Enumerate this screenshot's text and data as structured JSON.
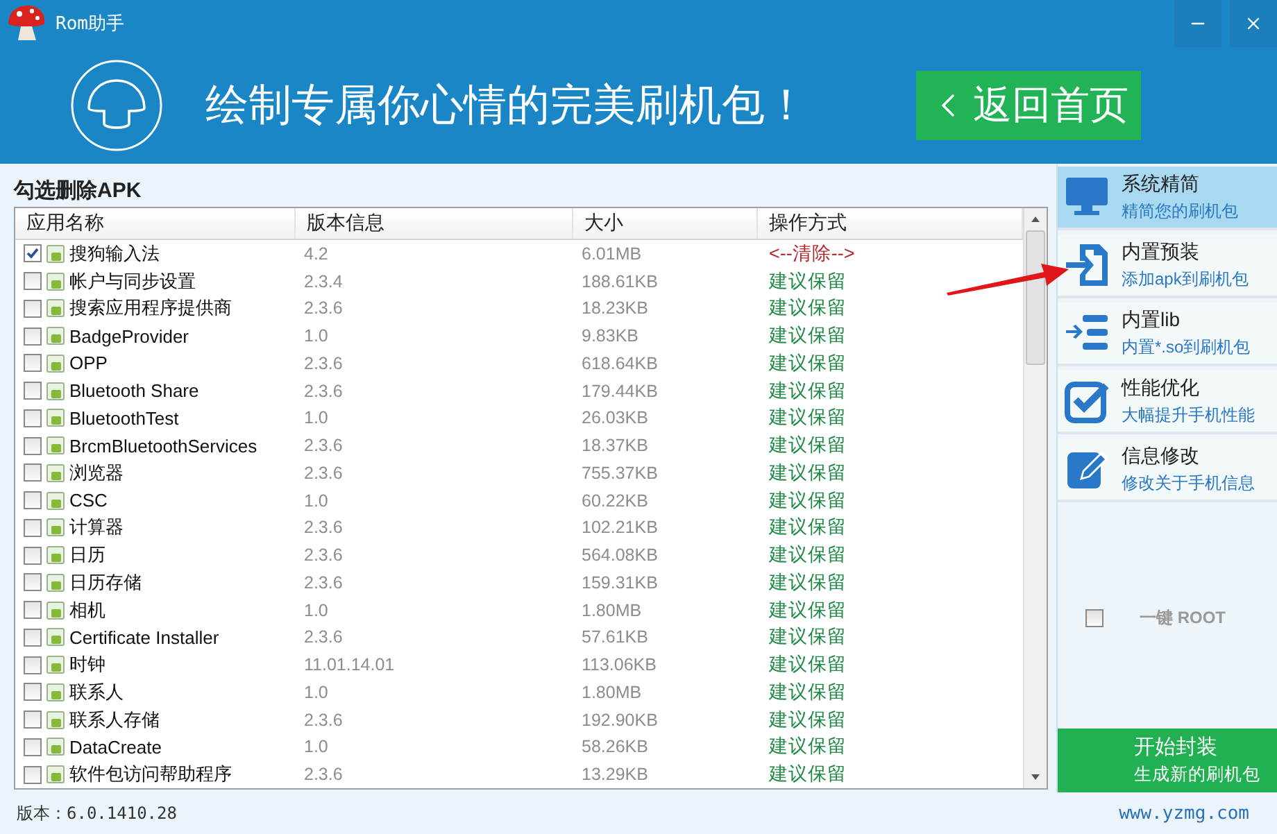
{
  "window": {
    "title": "Rom助手"
  },
  "banner": {
    "slogan": "绘制专属你心情的完美刷机包！",
    "back_button": "返回首页"
  },
  "panel_title": "勾选删除APK",
  "table": {
    "columns": [
      "应用名称",
      "版本信息",
      "大小",
      "操作方式"
    ],
    "rows": [
      {
        "checked": true,
        "name": "搜狗输入法",
        "version": "4.2",
        "size": "6.01MB",
        "action": "<--清除-->",
        "kind": "remove"
      },
      {
        "checked": false,
        "name": "帐户与同步设置",
        "version": "2.3.4",
        "size": "188.61KB",
        "action": "建议保留",
        "kind": "keep"
      },
      {
        "checked": false,
        "name": "搜索应用程序提供商",
        "version": "2.3.6",
        "size": "18.23KB",
        "action": "建议保留",
        "kind": "keep"
      },
      {
        "checked": false,
        "name": "BadgeProvider",
        "version": "1.0",
        "size": "9.83KB",
        "action": "建议保留",
        "kind": "keep"
      },
      {
        "checked": false,
        "name": "OPP",
        "version": "2.3.6",
        "size": "618.64KB",
        "action": "建议保留",
        "kind": "keep"
      },
      {
        "checked": false,
        "name": "Bluetooth Share",
        "version": "2.3.6",
        "size": "179.44KB",
        "action": "建议保留",
        "kind": "keep"
      },
      {
        "checked": false,
        "name": "BluetoothTest",
        "version": "1.0",
        "size": "26.03KB",
        "action": "建议保留",
        "kind": "keep"
      },
      {
        "checked": false,
        "name": "BrcmBluetoothServices",
        "version": "2.3.6",
        "size": "18.37KB",
        "action": "建议保留",
        "kind": "keep"
      },
      {
        "checked": false,
        "name": "浏览器",
        "version": "2.3.6",
        "size": "755.37KB",
        "action": "建议保留",
        "kind": "keep"
      },
      {
        "checked": false,
        "name": "CSC",
        "version": "1.0",
        "size": "60.22KB",
        "action": "建议保留",
        "kind": "keep"
      },
      {
        "checked": false,
        "name": "计算器",
        "version": "2.3.6",
        "size": "102.21KB",
        "action": "建议保留",
        "kind": "keep"
      },
      {
        "checked": false,
        "name": "日历",
        "version": "2.3.6",
        "size": "564.08KB",
        "action": "建议保留",
        "kind": "keep"
      },
      {
        "checked": false,
        "name": "日历存储",
        "version": "2.3.6",
        "size": "159.31KB",
        "action": "建议保留",
        "kind": "keep"
      },
      {
        "checked": false,
        "name": "相机",
        "version": "1.0",
        "size": "1.80MB",
        "action": "建议保留",
        "kind": "keep"
      },
      {
        "checked": false,
        "name": "Certificate Installer",
        "version": "2.3.6",
        "size": "57.61KB",
        "action": "建议保留",
        "kind": "keep"
      },
      {
        "checked": false,
        "name": "时钟",
        "version": "11.01.14.01",
        "size": "113.06KB",
        "action": "建议保留",
        "kind": "keep"
      },
      {
        "checked": false,
        "name": "联系人",
        "version": "1.0",
        "size": "1.80MB",
        "action": "建议保留",
        "kind": "keep"
      },
      {
        "checked": false,
        "name": "联系人存储",
        "version": "2.3.6",
        "size": "192.90KB",
        "action": "建议保留",
        "kind": "keep"
      },
      {
        "checked": false,
        "name": "DataCreate",
        "version": "1.0",
        "size": "58.26KB",
        "action": "建议保留",
        "kind": "keep"
      },
      {
        "checked": false,
        "name": "软件包访问帮助程序",
        "version": "2.3.6",
        "size": "13.29KB",
        "action": "建议保留",
        "kind": "keep"
      }
    ]
  },
  "sidebar": {
    "items": [
      {
        "title": "系统精简",
        "subtitle": "精简您的刷机包",
        "selected": true
      },
      {
        "title": "内置预装",
        "subtitle": "添加apk到刷机包",
        "selected": false
      },
      {
        "title": "内置lib",
        "subtitle": "内置*.so到刷机包",
        "selected": false
      },
      {
        "title": "性能优化",
        "subtitle": "大幅提升手机性能",
        "selected": false
      },
      {
        "title": "信息修改",
        "subtitle": "修改关于手机信息",
        "selected": false
      }
    ],
    "root_option": {
      "label": "一键 ROOT",
      "checked": false
    },
    "pack_button": {
      "title": "开始封装",
      "subtitle": "生成新的刷机包"
    }
  },
  "status_bar": {
    "version": "版本：6.0.1410.28",
    "website": "www.yzmg.com"
  }
}
